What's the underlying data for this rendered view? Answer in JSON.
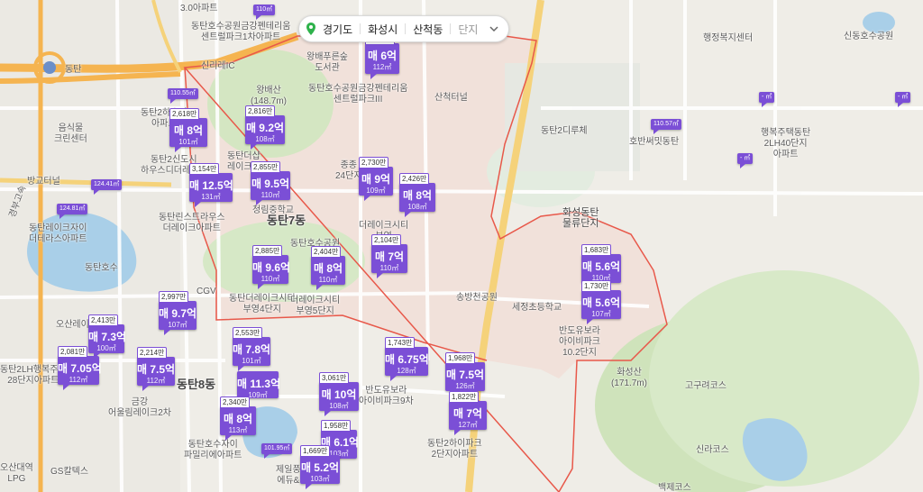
{
  "breadcrumb": {
    "province": "경기도",
    "city": "화성시",
    "district": "산척동",
    "level": "단지"
  },
  "colors": {
    "marker": "#7b4fd6",
    "boundary": "#e8584a",
    "park": "#d4e6c2",
    "water": "#a9cfe8",
    "highway": "#f5b450"
  },
  "place_labels": [
    {
      "id": "donggtan7dong",
      "text": "동탄7동"
    },
    {
      "id": "donggtan8dong",
      "text": "동탄8동"
    },
    {
      "id": "wangbaesan",
      "text": "왕배산\n(148.7m)"
    },
    {
      "id": "hwaseongsan",
      "text": "화성산\n(171.7m)"
    },
    {
      "id": "dongtanho",
      "text": "동탄호수"
    },
    {
      "id": "dongtanhopark",
      "text": "동탄호수공원"
    },
    {
      "id": "sancheoktunnel",
      "text": "산척터널"
    },
    {
      "id": "singeraeic",
      "text": "신리레IC"
    },
    {
      "id": "bangyotunnel",
      "text": "방교터널"
    },
    {
      "id": "gyeongbuexp",
      "text": "경부고속"
    },
    {
      "id": "donggtan",
      "text": "동탄"
    },
    {
      "id": "cgv",
      "text": "CGV"
    },
    {
      "id": "songbangcheon",
      "text": "송방천공원"
    },
    {
      "id": "sejeongelem",
      "text": "세정초등학교"
    },
    {
      "id": "logistics",
      "text": "화성동탄\n물류단지"
    },
    {
      "id": "cheongrim",
      "text": "청림중학교"
    },
    {
      "id": "wangbae_lib",
      "text": "왕배푸른숲\n도서관"
    },
    {
      "id": "dongtan2dirye",
      "text": "동탄2디루체"
    },
    {
      "id": "hobaneudong",
      "text": "호반써밋동탄"
    },
    {
      "id": "haengbok40",
      "text": "행복주택동탄\n2LH40단지\n아파트"
    },
    {
      "id": "haengjeong",
      "text": "행정복지센터"
    },
    {
      "id": "singdong_park",
      "text": "신동호수공원"
    },
    {
      "id": "ohsanglake",
      "text": "오산레이크"
    },
    {
      "id": "golf1",
      "text": "고구려코스"
    },
    {
      "id": "golf2",
      "text": "신라코스"
    },
    {
      "id": "golf3",
      "text": "백제코스"
    },
    {
      "id": "eumcrean",
      "text": "음식물\n크린센터"
    },
    {
      "id": "apt_a",
      "text": "동탄호수공원금강펜테리움\n센트럴파크III"
    },
    {
      "id": "apt_b",
      "text": "동탄호수공원금강펜테리움\n센트럴파크1차아파트"
    },
    {
      "id": "apt_c",
      "text": "동탄더레이크시티\n부영4단지"
    },
    {
      "id": "apt_d",
      "text": "더레이크시티\n부영5단지"
    },
    {
      "id": "apt_e",
      "text": "동탄린스트라우스\n더레이크아파트"
    },
    {
      "id": "apt_f",
      "text": "반도유보라\n아이비파크\n10.2단지"
    },
    {
      "id": "apt_g",
      "text": "동탄2하우징\n아파트"
    },
    {
      "id": "apt_h",
      "text": "동탄2신도시\n하우스디더레이크"
    },
    {
      "id": "apt_i",
      "text": "동탄레이크자이\n더테라스아파트"
    },
    {
      "id": "apt_j",
      "text": "동탄2LH행복주택\n28단지아파트"
    },
    {
      "id": "apt_k",
      "text": "동탄2하이파크\n2단지아파트"
    },
    {
      "id": "apt_l",
      "text": "동탄호수자이\n파밀리에아파트"
    },
    {
      "id": "apt_m",
      "text": "금강\n어울림레이크2차"
    },
    {
      "id": "apt_n",
      "text": "반도유보라\n아이비파크9차"
    },
    {
      "id": "apt_o",
      "text": "제일풍경채\n에듀&파크"
    },
    {
      "id": "apt_p",
      "text": "더레이크시티\n부영"
    },
    {
      "id": "apt_q",
      "text": "종종\n24단지"
    },
    {
      "id": "apt_r",
      "text": "3.0아파트"
    },
    {
      "id": "apt_s",
      "text": "오산대역\nLPG"
    },
    {
      "id": "apt_t",
      "text": "GS칼텍스"
    },
    {
      "id": "apt_u",
      "text": "동탄더샵\n레이크에"
    }
  ],
  "listings": [
    {
      "id": "m01",
      "price_top": "1,771만",
      "label": "매 6억",
      "area": "112㎡"
    },
    {
      "id": "m02",
      "price_top": "2,618만",
      "label": "매 8억",
      "area": "101㎡"
    },
    {
      "id": "m03",
      "price_top": "2,816만",
      "label": "매 9.2억",
      "area": "108㎡"
    },
    {
      "id": "m04",
      "price_top": "3,154만",
      "label": "매 12.5억",
      "area": "131㎡"
    },
    {
      "id": "m05",
      "price_top": "2,855만",
      "label": "매 9.5억",
      "area": "110㎡"
    },
    {
      "id": "m06",
      "price_top": "2,730만",
      "label": "매 9억",
      "area": "109㎡"
    },
    {
      "id": "m07",
      "price_top": "2,426만",
      "label": "매 8억",
      "area": "108㎡"
    },
    {
      "id": "m08",
      "price_top": "2,104만",
      "label": "매 7억",
      "area": "110㎡"
    },
    {
      "id": "m09",
      "price_top": "2,885만",
      "label": "매 9.6억",
      "area": "110㎡"
    },
    {
      "id": "m10",
      "price_top": "2,404만",
      "label": "매 8억",
      "area": "110㎡"
    },
    {
      "id": "m11",
      "price_top": "2,997만",
      "label": "매 9.7억",
      "area": "107㎡"
    },
    {
      "id": "m12",
      "price_top": "2,413만",
      "label": "매 7.3억",
      "area": "100㎡"
    },
    {
      "id": "m13",
      "price_top": "2,081만",
      "label": "매 7.05억",
      "area": "112㎡"
    },
    {
      "id": "m14",
      "price_top": "2,214만",
      "label": "매 7.5억",
      "area": "112㎡"
    },
    {
      "id": "m15",
      "price_top": "2,553만",
      "label": "매 7.8억",
      "area": "101㎡"
    },
    {
      "id": "m16",
      "price_top": "",
      "label": "매 11.3억",
      "area": "109㎡"
    },
    {
      "id": "m17",
      "price_top": "2,340만",
      "label": "매 8억",
      "area": "113㎡"
    },
    {
      "id": "m18",
      "price_top": "3,061만",
      "label": "매 10억",
      "area": "108㎡"
    },
    {
      "id": "m19",
      "price_top": "1,743만",
      "label": "매 6.75억",
      "area": "128㎡"
    },
    {
      "id": "m20",
      "price_top": "1,968만",
      "label": "매 7.5억",
      "area": "126㎡"
    },
    {
      "id": "m21",
      "price_top": "1,822만",
      "label": "매 7억",
      "area": "127㎡"
    },
    {
      "id": "m22",
      "price_top": "1,958만",
      "label": "매 6.1억",
      "area": "103㎡"
    },
    {
      "id": "m23",
      "price_top": "1,669만",
      "label": "매 5.2억",
      "area": "103㎡"
    },
    {
      "id": "m24",
      "price_top": "1,683만",
      "label": "매 5.6억",
      "area": "110㎡"
    },
    {
      "id": "m25",
      "price_top": "1,730만",
      "label": "매 5.6억",
      "area": "107㎡"
    }
  ],
  "area_markers": [
    {
      "id": "a01",
      "label": "110.55㎡"
    },
    {
      "id": "a02",
      "label": "124.41㎡"
    },
    {
      "id": "a03",
      "label": "124.81㎡"
    },
    {
      "id": "a04",
      "label": "110.57㎡"
    },
    {
      "id": "a05",
      "label": "- ㎡"
    },
    {
      "id": "a06",
      "label": "- ㎡"
    },
    {
      "id": "a07",
      "label": "- ㎡"
    },
    {
      "id": "a08",
      "label": "101.95㎡"
    },
    {
      "id": "a09",
      "label": "110㎡"
    }
  ]
}
